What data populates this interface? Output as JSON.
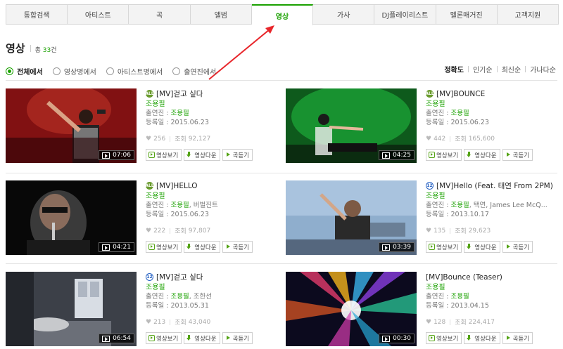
{
  "tabs": [
    {
      "label": "통합검색"
    },
    {
      "label": "아티스트"
    },
    {
      "label": "곡"
    },
    {
      "label": "앨범"
    },
    {
      "label": "영상",
      "active": true
    },
    {
      "label": "가사"
    },
    {
      "label": "DJ플레이리스트"
    },
    {
      "label": "멜론매거진"
    },
    {
      "label": "고객지원"
    }
  ],
  "heading": {
    "title": "영상",
    "total_prefix": "총",
    "count": "33",
    "count_suffix": "건"
  },
  "filters": [
    {
      "label": "전체에서",
      "selected": true
    },
    {
      "label": "영상명에서"
    },
    {
      "label": "아티스트명에서"
    },
    {
      "label": "출연진에서"
    }
  ],
  "sorts": [
    "정확도",
    "인기순",
    "최신순",
    "가나다순"
  ],
  "labels": {
    "cast": "출연진 :",
    "date": "등록일 :",
    "views": "조회",
    "watch": "영상보기",
    "download": "영상다운",
    "listen": "곡듣기"
  },
  "videos": [
    {
      "title": "[MV]걷고 싶다",
      "badge": "all",
      "artist": "조용필",
      "cast": "조용필",
      "cast_extra": "",
      "date": "2015.06.23",
      "likes": "256",
      "views": "92,127",
      "duration": "07:06"
    },
    {
      "title": "[MV]BOUNCE",
      "badge": "all",
      "artist": "조용필",
      "cast": "조용필",
      "cast_extra": "",
      "date": "2015.06.23",
      "likes": "442",
      "views": "165,600",
      "duration": "04:25"
    },
    {
      "title": "[MV]HELLO",
      "badge": "all",
      "artist": "조용필",
      "cast": "조용필",
      "cast_extra": ", 버벌진트",
      "date": "2015.06.23",
      "likes": "222",
      "views": "97,807",
      "duration": "04:21"
    },
    {
      "title": "[MV]Hello (Feat. 태연 From 2PM)",
      "badge": "12",
      "artist": "조용필",
      "cast": "조용필",
      "cast_extra": ", 택연, James Lee McQ...",
      "date": "2013.10.17",
      "likes": "135",
      "views": "29,623",
      "duration": "03:39"
    },
    {
      "title": "[MV]걷고 싶다",
      "badge": "12",
      "artist": "조용필",
      "cast": "조용필",
      "cast_extra": ", 조한선",
      "date": "2013.05.31",
      "likes": "213",
      "views": "43,040",
      "duration": "06:54"
    },
    {
      "title": "[MV]Bounce (Teaser)",
      "badge": "",
      "artist": "조용필",
      "cast": "조용필",
      "cast_extra": "",
      "date": "2013.04.15",
      "likes": "128",
      "views": "224,417",
      "duration": "00:30"
    }
  ],
  "colors": {
    "accent": "#1aa100",
    "arrow": "#e8262b"
  }
}
